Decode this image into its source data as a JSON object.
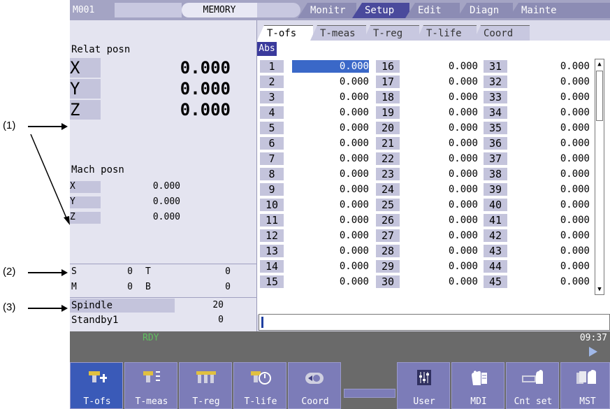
{
  "callouts": [
    "(1)",
    "(2)",
    "(3)"
  ],
  "topbar": {
    "id": "M001",
    "mode": "MEMORY",
    "tabs": [
      "Monitr",
      "Setup",
      "Edit",
      "Diagn",
      "Mainte"
    ],
    "active_tab": "Setup"
  },
  "relat": {
    "title": "Relat posn",
    "axes": [
      {
        "axis": "X",
        "value": "0.000"
      },
      {
        "axis": "Y",
        "value": "0.000"
      },
      {
        "axis": "Z",
        "value": "0.000"
      }
    ]
  },
  "mach": {
    "title": "Mach posn",
    "axes": [
      {
        "axis": "X",
        "value": "0.000"
      },
      {
        "axis": "Y",
        "value": "0.000"
      },
      {
        "axis": "Z",
        "value": "0.000"
      }
    ]
  },
  "modal": {
    "s_label": "S",
    "s_value": "0",
    "t_label": "T",
    "t_value": "0",
    "m_label": "M",
    "m_value": "0",
    "b_label": "B",
    "b_value": "0"
  },
  "spindle": {
    "label": "Spindle",
    "value": "20",
    "standby_label": "Standby1",
    "standby_value": "0"
  },
  "subtabs": [
    "T-ofs",
    "T-meas",
    "T-reg",
    "T-life",
    "Coord"
  ],
  "active_subtab": "T-ofs",
  "table": {
    "abs_label": "Abs",
    "columns": [
      {
        "nums": [
          "1",
          "2",
          "3",
          "4",
          "5",
          "6",
          "7",
          "8",
          "9",
          "10",
          "11",
          "12",
          "13",
          "14",
          "15"
        ],
        "values": [
          "0.000",
          "0.000",
          "0.000",
          "0.000",
          "0.000",
          "0.000",
          "0.000",
          "0.000",
          "0.000",
          "0.000",
          "0.000",
          "0.000",
          "0.000",
          "0.000",
          "0.000"
        ]
      },
      {
        "nums": [
          "16",
          "17",
          "18",
          "19",
          "20",
          "21",
          "22",
          "23",
          "24",
          "25",
          "26",
          "27",
          "28",
          "29",
          "30"
        ],
        "values": [
          "0.000",
          "0.000",
          "0.000",
          "0.000",
          "0.000",
          "0.000",
          "0.000",
          "0.000",
          "0.000",
          "0.000",
          "0.000",
          "0.000",
          "0.000",
          "0.000",
          "0.000"
        ]
      },
      {
        "nums": [
          "31",
          "32",
          "33",
          "34",
          "35",
          "36",
          "37",
          "38",
          "39",
          "40",
          "41",
          "42",
          "43",
          "44",
          "45"
        ],
        "values": [
          "0.000",
          "0.000",
          "0.000",
          "0.000",
          "0.000",
          "0.000",
          "0.000",
          "0.000",
          "0.000",
          "0.000",
          "0.000",
          "0.000",
          "0.000",
          "0.000",
          "0.000"
        ]
      }
    ],
    "selected": "1"
  },
  "status": {
    "ready": "RDY",
    "time": "09:37"
  },
  "softkeys": [
    {
      "label": "T-ofs",
      "icon": "tool-offset-icon",
      "active": true
    },
    {
      "label": "T-meas",
      "icon": "tool-measure-icon",
      "active": false
    },
    {
      "label": "T-reg",
      "icon": "tool-register-icon",
      "active": false
    },
    {
      "label": "T-life",
      "icon": "tool-life-icon",
      "active": false
    },
    {
      "label": "Coord",
      "icon": "coordinate-icon",
      "active": false
    },
    {
      "label": "",
      "icon": "",
      "active": false
    },
    {
      "label": "User",
      "icon": "user-sliders-icon",
      "active": false
    },
    {
      "label": "MDI",
      "icon": "mdi-hand-icon",
      "active": false
    },
    {
      "label": "Cnt set",
      "icon": "counter-set-icon",
      "active": false
    },
    {
      "label": "MST",
      "icon": "mst-hand-icon",
      "active": false
    }
  ],
  "colors": {
    "accent": "#3a5ab8",
    "selected_cell": "#3a68c8",
    "ready": "#60c060"
  }
}
